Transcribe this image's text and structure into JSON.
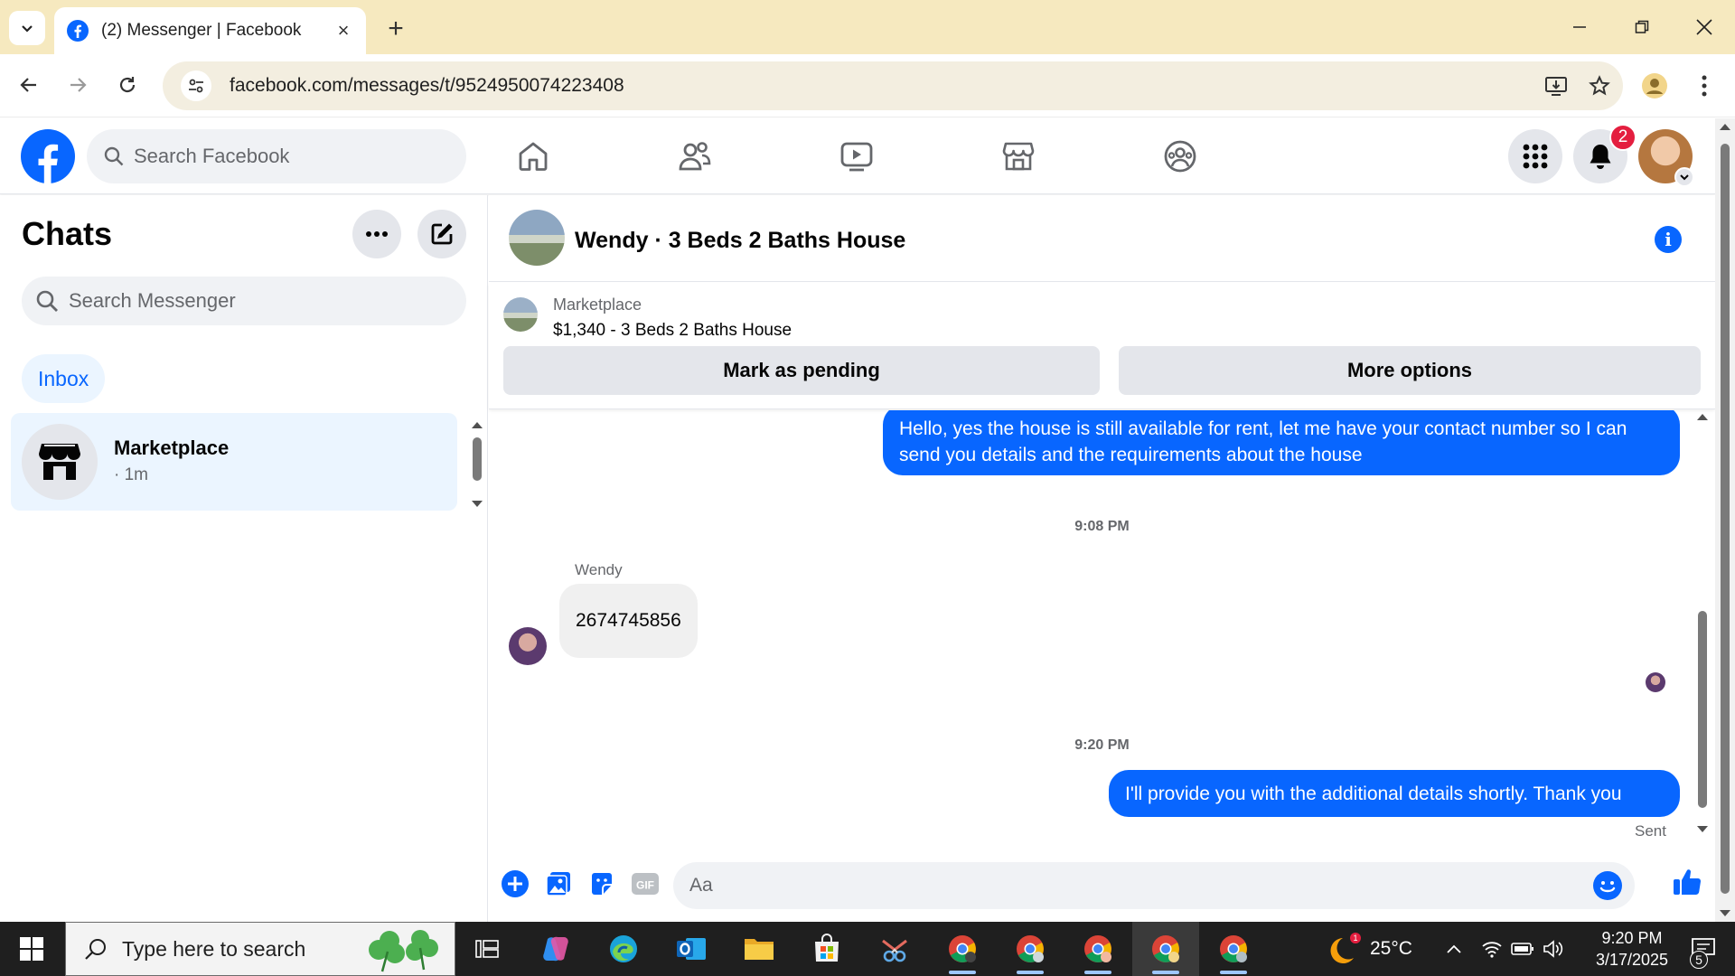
{
  "browser": {
    "tab_title": "(2) Messenger | Facebook",
    "url": "facebook.com/messages/t/9524950074223408"
  },
  "facebook": {
    "search_placeholder": "Search Facebook",
    "notification_count": "2",
    "brand_color": "#0866ff"
  },
  "chats": {
    "title": "Chats",
    "search_placeholder": "Search Messenger",
    "filter_label": "Inbox",
    "items": [
      {
        "name": "Marketplace",
        "time": "· 1m",
        "icon": "marketplace-store-icon"
      }
    ]
  },
  "conversation": {
    "title": "Wendy · 3 Beds 2 Baths House",
    "listing": {
      "source": "Marketplace",
      "title": "$1,340 - 3 Beds 2 Baths House",
      "mark_pending_label": "Mark as pending",
      "more_options_label": "More options"
    },
    "messages": [
      {
        "direction": "outgoing",
        "text": "Hello, yes the house is still available for rent, let me have your contact number so I can send you details and the requirements about the house"
      },
      {
        "type": "timestamp",
        "text": "9:08 PM"
      },
      {
        "direction": "incoming",
        "sender": "Wendy",
        "text": "2674745856"
      },
      {
        "type": "timestamp",
        "text": "9:20 PM"
      },
      {
        "direction": "outgoing",
        "text": "I'll provide you with the additional details shortly. Thank you",
        "status": "Sent"
      }
    ],
    "composer_placeholder": "Aa"
  },
  "taskbar": {
    "search_placeholder": "Type here to search",
    "weather_temp": "25°C",
    "weather_badge": "1",
    "time": "9:20 PM",
    "date": "3/17/2025",
    "notification_count": "5"
  }
}
